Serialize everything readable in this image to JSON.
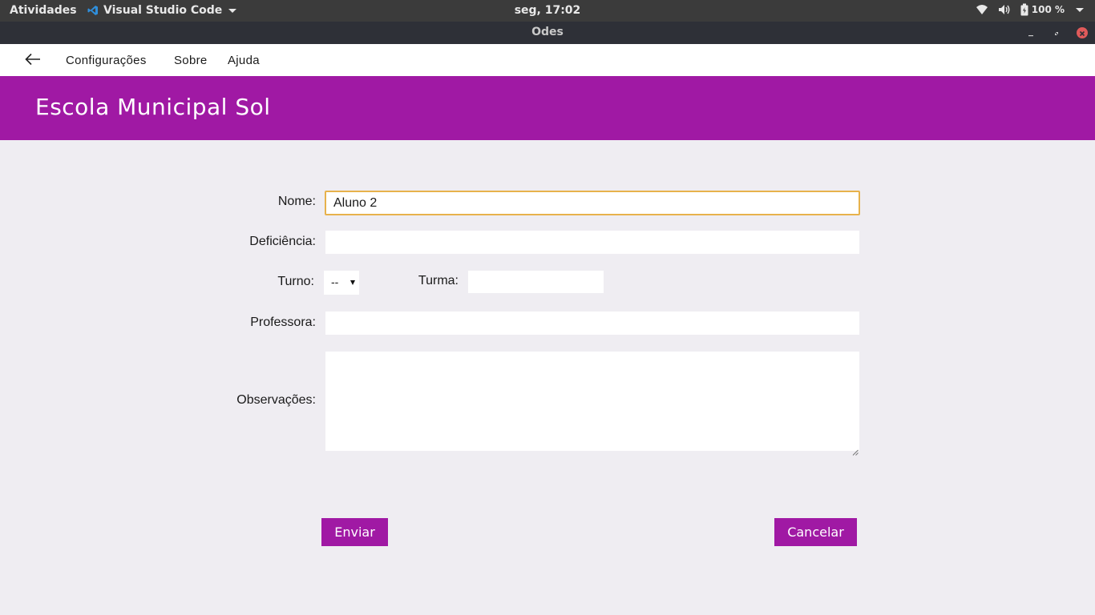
{
  "system_bar": {
    "activities": "Atividades",
    "app_name": "Visual Studio Code",
    "clock": "seg, 17:02",
    "battery": "100 %",
    "icons": [
      "wifi-icon",
      "volume-icon",
      "battery-icon",
      "system-menu-caret-icon"
    ]
  },
  "window": {
    "title": "Odes",
    "controls": [
      "minimize-icon",
      "maximize-icon",
      "close-icon"
    ]
  },
  "menu": {
    "back_icon": "arrow-left-icon",
    "items": [
      "Configurações",
      "Sobre",
      "Ajuda"
    ]
  },
  "header": {
    "title": "Escola Municipal Sol"
  },
  "form": {
    "nome": {
      "label": "Nome:",
      "value": "Aluno 2"
    },
    "deficiencia": {
      "label": "Deficiência:",
      "value": ""
    },
    "turno": {
      "label": "Turno:",
      "selected": "--"
    },
    "turma": {
      "label": "Turma:",
      "value": ""
    },
    "professora": {
      "label": "Professora:",
      "value": ""
    },
    "observacoes": {
      "label": "Observações:",
      "value": ""
    }
  },
  "buttons": {
    "submit": "Enviar",
    "cancel": "Cancelar"
  },
  "colors": {
    "accent": "#a019a4",
    "focus_border": "#e7b24c",
    "background": "#efedf2",
    "topbar": "#3b3b3b",
    "titlebar": "#2e3037"
  }
}
